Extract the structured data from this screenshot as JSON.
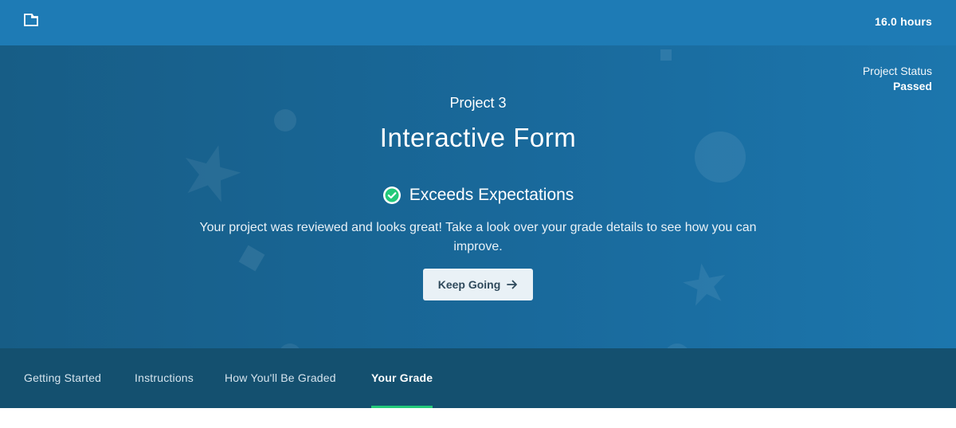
{
  "header": {
    "icon": "folder-icon",
    "hours": "16.0 hours"
  },
  "status": {
    "label": "Project Status",
    "value": "Passed"
  },
  "project": {
    "number": "Project 3",
    "title": "Interactive Form"
  },
  "grade": {
    "icon": "check-circle-icon",
    "label": "Exceeds Expectations",
    "description": "Your project was reviewed and looks great! Take a look over your grade details to see how you can improve."
  },
  "cta": {
    "label": "Keep Going",
    "icon": "arrow-right-icon"
  },
  "tabs": [
    {
      "label": "Getting Started",
      "active": false
    },
    {
      "label": "Instructions",
      "active": false
    },
    {
      "label": "How You'll Be Graded",
      "active": false
    },
    {
      "label": "Your Grade",
      "active": true
    }
  ],
  "colors": {
    "topbar": "#1e7bb5",
    "hero": "#19699b",
    "tabbar": "#14506f",
    "success": "#23c97a"
  }
}
